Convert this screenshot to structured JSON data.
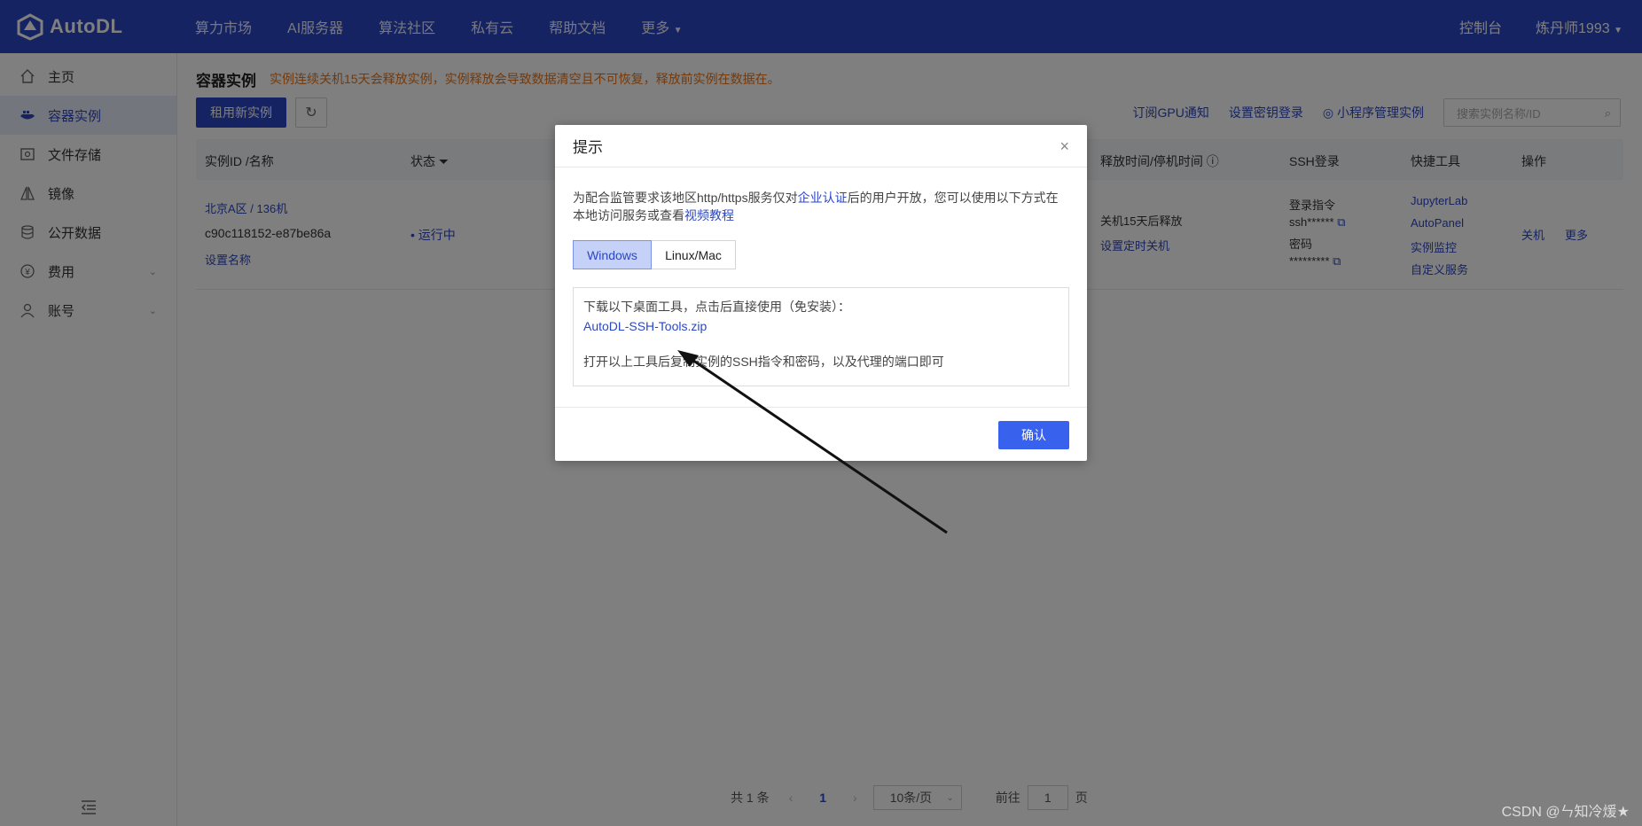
{
  "header": {
    "brand": "AutoDL",
    "nav": [
      "算力市场",
      "AI服务器",
      "算法社区",
      "私有云",
      "帮助文档",
      "更多"
    ],
    "console": "控制台",
    "user": "炼丹师1993"
  },
  "sidebar": {
    "items": [
      {
        "label": "主页",
        "icon": "home-icon"
      },
      {
        "label": "容器实例",
        "icon": "container-icon",
        "active": true
      },
      {
        "label": "文件存储",
        "icon": "storage-icon"
      },
      {
        "label": "镜像",
        "icon": "image-icon"
      },
      {
        "label": "公开数据",
        "icon": "database-icon"
      },
      {
        "label": "费用",
        "icon": "yen-icon",
        "expandable": true
      },
      {
        "label": "账号",
        "icon": "user-icon",
        "expandable": true
      }
    ]
  },
  "main": {
    "title": "容器实例",
    "warning": "实例连续关机15天会释放实例，实例释放会导致数据清空且不可恢复，释放前实例在数据在。",
    "rent_button": "租用新实例",
    "links": [
      "订阅GPU通知",
      "设置密钥登录",
      "小程序管理实例"
    ],
    "search_placeholder": "搜索实例名称/ID",
    "columns": {
      "id": "实例ID /名称",
      "status": "状态",
      "release": "释放时间/停机时间",
      "ssh": "SSH登录",
      "tools": "快捷工具",
      "ops": "操作"
    },
    "row": {
      "region": "北京A区 / 136机",
      "instance_id": "c90c118152-e87be86a",
      "set_name": "设置名称",
      "status": "运行中",
      "release_text": "关机15天后释放",
      "set_shutdown": "设置定时关机",
      "ssh_cmd_label": "登录指令",
      "ssh_cmd": "ssh******",
      "pwd_label": "密码",
      "pwd": "*********",
      "tools": [
        "JupyterLab",
        "AutoPanel",
        "实例监控",
        "自定义服务"
      ],
      "op_shutdown": "关机",
      "op_more": "更多"
    },
    "pagination": {
      "total": "共 1 条",
      "page": "1",
      "page_size": "10条/页",
      "goto_label": "前往",
      "goto_value": "1",
      "goto_suffix": "页"
    }
  },
  "dialog": {
    "title": "提示",
    "desc_1": "为配合监管要求该地区http/https服务仅对",
    "desc_link_1": "企业认证",
    "desc_2": "后的用户开放，您可以使用以下方式在本地访问服务或查看",
    "desc_link_2": "视频教程",
    "tab_windows": "Windows",
    "tab_linux": "Linux/Mac",
    "download_text": "下载以下桌面工具，点击后直接使用（免安装）：",
    "download_link": "AutoDL-SSH-Tools.zip",
    "instruction": "打开以上工具后复制实例的SSH指令和密码，以及代理的端口即可",
    "confirm": "确认"
  },
  "watermark": "CSDN @ㄣ知冷煖★",
  "colors": {
    "brand": "#2c47c4",
    "warning": "#e6751a",
    "confirm": "#3861ee"
  }
}
